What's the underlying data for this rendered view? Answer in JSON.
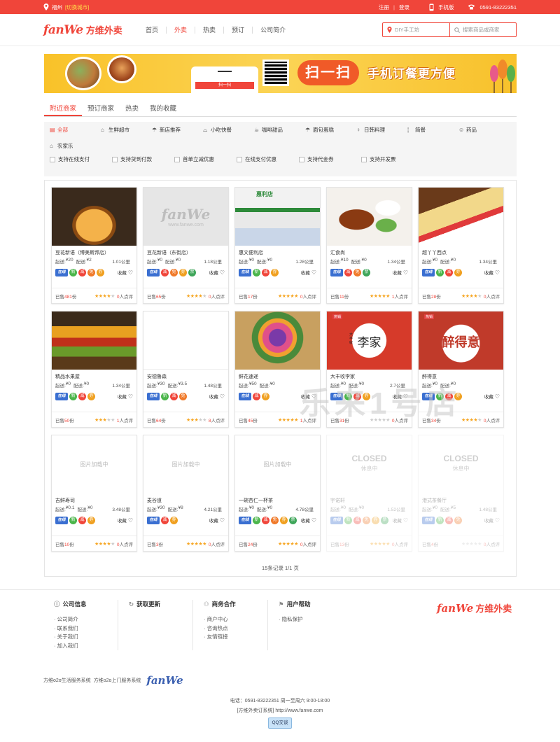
{
  "topbar": {
    "city": "福州",
    "switch_city": "[切换城市]",
    "register": "注册",
    "login": "登录",
    "mobile": "手机版",
    "phone": "0591-83222351"
  },
  "header": {
    "logo_en": "fanWe",
    "logo_cn": "方维外卖",
    "nav": [
      "首页",
      "外卖",
      "热卖",
      "预订",
      "公司简介"
    ],
    "city_placeholder": "DIY手工坊",
    "search_placeholder": "搜索商品或商家"
  },
  "banner": {
    "phone_bar": "扫一扫",
    "scan": "扫一扫",
    "slogan": "手机订餐更方便"
  },
  "tabs": [
    "附近商家",
    "预订商家",
    "热卖",
    "我的收藏"
  ],
  "categories": [
    "全部",
    "生鲜超市",
    "新店推荐",
    "小吃快餐",
    "咖啡甜品",
    "面包蛋糕",
    "日韩料理",
    "简餐",
    "药品",
    "农家乐"
  ],
  "options": [
    "支持在线支付",
    "支持货到付款",
    "首单立减优惠",
    "在线支付优惠",
    "支持代金券",
    "支持开发票"
  ],
  "labels": {
    "start": "起送:",
    "delivery": "配送:",
    "fav": "收藏",
    "sold_prefix": "已售",
    "sold_suffix": "份",
    "review_suffix": "人点评",
    "pay": "在线",
    "loading": "图片加载中",
    "closed": "CLOSED",
    "resting": "休息中",
    "watermark_url": "www.fanwe.com"
  },
  "shops": [
    {
      "name": "豆花新语（博美斯邦店）",
      "start": "¥20",
      "delivery": "¥2",
      "dist": "1.01公里",
      "badges": [
        "pay",
        "xin",
        "jian",
        "mian",
        "quan"
      ],
      "sold": "481",
      "stars": 4,
      "reviews": "0"
    },
    {
      "name": "豆花新语（东街店）",
      "start": "¥0",
      "delivery": "¥0",
      "dist": "1.18公里",
      "badges": [
        "pay",
        "jian",
        "mian",
        "quan",
        "piao"
      ],
      "sold": "65",
      "stars": 4,
      "reviews": "0"
    },
    {
      "name": "惠文便利店",
      "start": "¥0",
      "delivery": "¥0",
      "dist": "1.28公里",
      "badges": [
        "pay",
        "xin",
        "jian",
        "quan"
      ],
      "sold": "17",
      "stars": 5,
      "reviews": "0"
    },
    {
      "name": "汇食尚",
      "start": "¥10",
      "delivery": "¥0",
      "dist": "1.34公里",
      "badges": [
        "pay",
        "jian",
        "mian",
        "piao"
      ],
      "sold": "11",
      "stars": 5,
      "reviews": "1"
    },
    {
      "name": "超丫丫西点",
      "start": "¥0",
      "delivery": "¥0",
      "dist": "1.34公里",
      "badges": [
        "pay",
        "xin",
        "jian",
        "quan"
      ],
      "sold": "28",
      "stars": 4,
      "reviews": "0"
    },
    {
      "name": "精品水果屋",
      "start": "¥0",
      "delivery": "¥0",
      "dist": "1.34公里",
      "badges": [
        "pay",
        "xin",
        "jian",
        "quan"
      ],
      "sold": "50",
      "stars": 3,
      "reviews": "1"
    },
    {
      "name": "安德鲁森",
      "start": "¥30",
      "delivery": "¥3.5",
      "dist": "1.48公里",
      "badges": [
        "pay",
        "xin",
        "jian",
        "mian"
      ],
      "sold": "64",
      "stars": 3,
      "reviews": "8"
    },
    {
      "name": "鲜花速递",
      "start": "¥50",
      "delivery": "¥0",
      "dist": "",
      "badges": [
        "pay",
        "jian",
        "quan"
      ],
      "sold": "45",
      "stars": 5,
      "reviews": "1"
    },
    {
      "name": "大丰收李家",
      "start": "¥0",
      "delivery": "¥0",
      "dist": "2.7公里",
      "badges": [
        "pay",
        "xin",
        "jian",
        "quan"
      ],
      "sold": "31",
      "stars": 0,
      "reviews": "0"
    },
    {
      "name": "醉得意",
      "start": "¥0",
      "delivery": "¥0",
      "dist": "",
      "badges": [
        "pay",
        "xin",
        "jian",
        "quan"
      ],
      "sold": "34",
      "stars": 4,
      "reviews": "0"
    },
    {
      "name": "吉鲜寿司",
      "start": "¥0.1",
      "delivery": "¥0",
      "dist": "3.48公里",
      "badges": [
        "pay",
        "xin",
        "jian",
        "quan"
      ],
      "sold": "10",
      "stars": 4,
      "reviews": "0"
    },
    {
      "name": "麦谷道",
      "start": "¥30",
      "delivery": "¥8",
      "dist": "4.21公里",
      "badges": [
        "pay",
        "jian",
        "quan"
      ],
      "sold": "3",
      "stars": 5,
      "reviews": "0"
    },
    {
      "name": "一碗杏仁一杯茶",
      "start": "¥0",
      "delivery": "¥0",
      "dist": "4.78公里",
      "badges": [
        "pay",
        "xin",
        "jian",
        "mian",
        "quan",
        "piao"
      ],
      "sold": "24",
      "stars": 5,
      "reviews": "0"
    },
    {
      "name": "宇诺轩",
      "start": "¥0",
      "delivery": "¥0",
      "dist": "1.52公里",
      "badges": [
        "pay",
        "xin",
        "jian",
        "mian",
        "quan",
        "piao"
      ],
      "sold": "13",
      "stars": 5,
      "reviews": "0"
    },
    {
      "name": "港式茶餐厅",
      "start": "¥0",
      "delivery": "¥5",
      "dist": "1.48公里",
      "badges": [
        "pay",
        "xin",
        "jian",
        "mian"
      ],
      "sold": "4",
      "stars": 0,
      "reviews": "0"
    }
  ],
  "pager": "15条记录 1/1 页",
  "overlay": "乐来1号店",
  "shop_image_text": {
    "s2": "惠利店",
    "s8": "李家",
    "s8_small": "大丰收",
    "s9": "醉得意",
    "s8_tag": "热销"
  },
  "footer": {
    "cols": [
      {
        "title": "公司信息",
        "items": [
          "公司简介",
          "联系我们",
          "关于我们",
          "加入我们"
        ]
      },
      {
        "title": "获取更新",
        "items": []
      },
      {
        "title": "商务合作",
        "items": [
          "商户中心",
          "咨询热点",
          "友情链接"
        ]
      },
      {
        "title": "用户帮助",
        "items": [
          "隐私保护"
        ]
      }
    ],
    "logo_en": "fanWe",
    "logo_cn": "方维外卖",
    "sys1": "方维o2o生活服务系统",
    "sys2": "方维o2o上门服务系统",
    "sys_logo": "fanWe",
    "contact": "电话：0591-83222351 周一至周六 9:00-18:00",
    "site": "[方维外卖订系统] http://www.fanwe.com",
    "qq": "QQ交谈"
  }
}
